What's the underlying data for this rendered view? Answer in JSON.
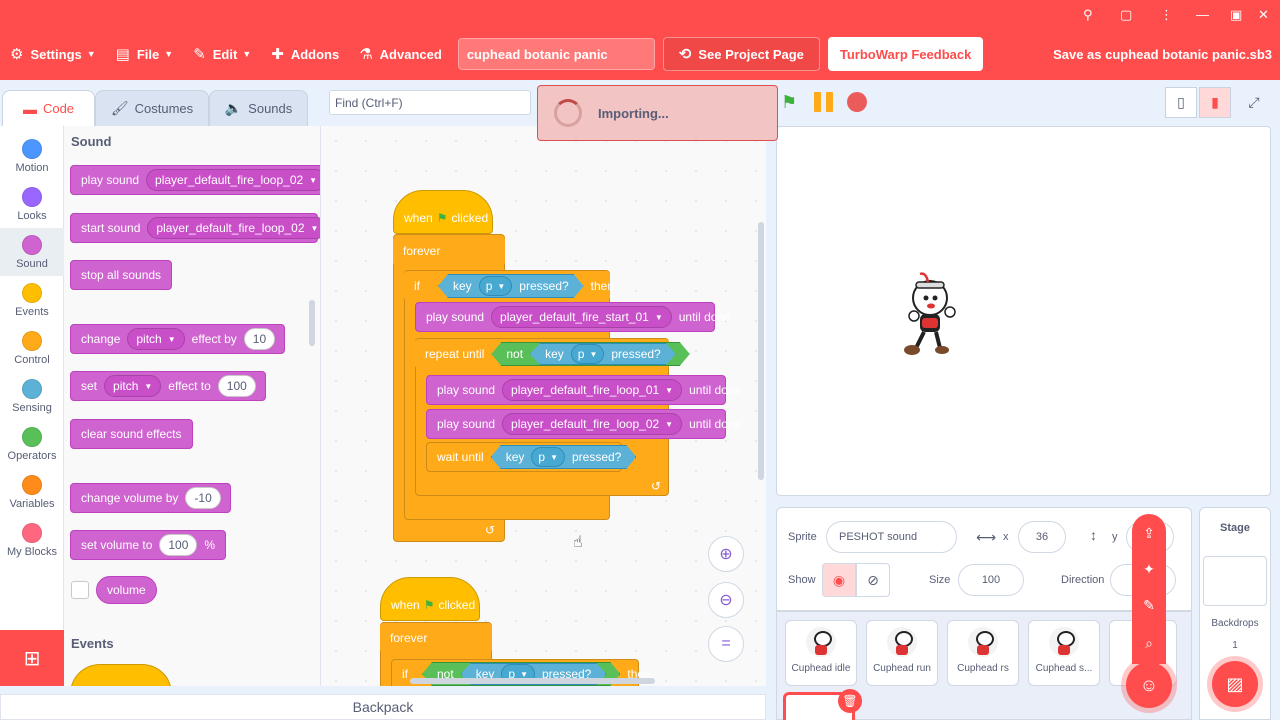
{
  "window": {
    "icons": [
      "zoom-icon",
      "page-icon",
      "more-icon",
      "minimize-icon",
      "maximize-icon",
      "close-icon"
    ]
  },
  "menu": {
    "settings": "Settings",
    "file": "File",
    "edit": "Edit",
    "addons": "Addons",
    "advanced": "Advanced",
    "project_title": "cuphead botanic panic",
    "see_project": "See Project Page",
    "feedback": "TurboWarp Feedback",
    "save_as": "Save as cuphead botanic panic.sb3"
  },
  "tabs": {
    "code": "Code",
    "costumes": "Costumes",
    "sounds": "Sounds"
  },
  "find": {
    "placeholder": "Find (Ctrl+F)"
  },
  "toast": {
    "text": "Importing..."
  },
  "categories": [
    {
      "label": "Motion",
      "color": "#4c97ff"
    },
    {
      "label": "Looks",
      "color": "#9966ff"
    },
    {
      "label": "Sound",
      "color": "#cf63cf"
    },
    {
      "label": "Events",
      "color": "#ffbf00"
    },
    {
      "label": "Control",
      "color": "#ffab19"
    },
    {
      "label": "Sensing",
      "color": "#5cb1d6"
    },
    {
      "label": "Operators",
      "color": "#59c059"
    },
    {
      "label": "Variables",
      "color": "#ff8c1a"
    },
    {
      "label": "My Blocks",
      "color": "#ff6680"
    }
  ],
  "palette": {
    "sound_heading": "Sound",
    "events_heading": "Events",
    "play_sound": "play sound",
    "start_sound": "start sound",
    "sound_name": "player_default_fire_loop_02",
    "stop_all": "stop all sounds",
    "change": "change",
    "effect_by": "effect by",
    "pitch": "pitch",
    "change_val": "10",
    "set": "set",
    "effect_to": "effect to",
    "set_val": "100",
    "clear_effects": "clear sound effects",
    "change_volume": "change volume by",
    "change_volume_val": "-10",
    "set_volume": "set volume to",
    "set_volume_val": "100",
    "percent": "%",
    "volume": "volume"
  },
  "script1": {
    "when": "when",
    "clicked": "clicked",
    "forever": "forever",
    "if": "if",
    "then": "then",
    "key": "key",
    "key_val": "p",
    "pressed": "pressed?",
    "play_sound": "play sound",
    "until_done": "until done",
    "sound_start": "player_default_fire_start_01",
    "repeat_until": "repeat until",
    "not": "not",
    "sound_loop1": "player_default_fire_loop_01",
    "sound_loop2": "player_default_fire_loop_02",
    "wait_until": "wait until"
  },
  "script2": {
    "when": "when",
    "clicked": "clicked",
    "forever": "forever",
    "if": "if",
    "not": "not",
    "key": "key",
    "key_val": "p",
    "pressed": "pressed?",
    "then": "then"
  },
  "backpack": "Backpack",
  "sprite_info": {
    "sprite_label": "Sprite",
    "sprite_name": "PESHOT sound",
    "x_label": "x",
    "x_val": "36",
    "y_label": "y",
    "show_label": "Show",
    "size_label": "Size",
    "size_val": "100",
    "direction_label": "Direction"
  },
  "sprites": [
    "Cuphead idle",
    "Cuphead run",
    "Cuphead rs",
    "Cuphead s..."
  ],
  "stage_panel": {
    "title": "Stage",
    "backdrops": "Backdrops",
    "count": "1"
  },
  "colors": {
    "accent": "#ff4c4c",
    "sound": "#cf63cf",
    "control": "#ffab19",
    "sensing": "#5cb1d6",
    "operators": "#59c059",
    "events": "#ffbf00"
  }
}
